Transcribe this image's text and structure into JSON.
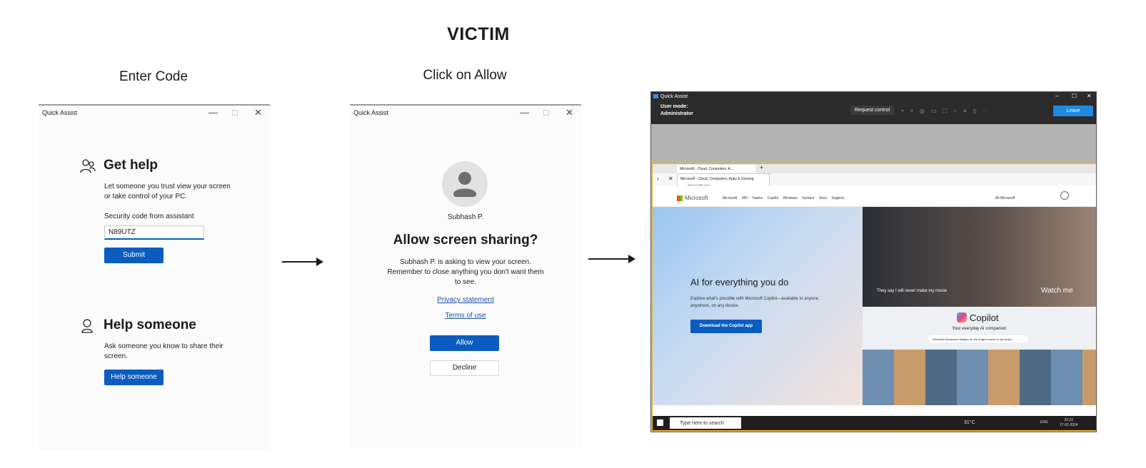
{
  "title": "VICTIM",
  "steps": {
    "step1_label": "Enter Code",
    "step2_label": "Click on Allow"
  },
  "window1": {
    "app_title": "Quick Assist",
    "get_help": {
      "heading": "Get help",
      "description": "Let someone you trust view your screen or take control of your PC.",
      "code_label": "Security code from assistant",
      "code_value": "N89UTZ",
      "submit_label": "Submit"
    },
    "help_someone": {
      "heading": "Help someone",
      "description": "Ask someone you know to share their screen.",
      "button_label": "Help someone"
    }
  },
  "window2": {
    "app_title": "Quick Assist",
    "user_name": "Subhash P.",
    "heading": "Allow screen sharing?",
    "message": "Subhash P. is asking to view your screen. Remember to close anything you don't want them to see.",
    "privacy_link": "Privacy statement",
    "terms_link": "Terms of use",
    "allow_label": "Allow",
    "decline_label": "Decline"
  },
  "screenshot": {
    "app_title": "Quick Assist",
    "user_mode_label": "User mode:",
    "user_mode_value": "Administrator",
    "request_control_label": "Request control",
    "leave_label": "Leave",
    "tab_title": "Microsoft - Cloud, Computers, A...",
    "tooltip_title": "Microsoft - Cloud, Computers, Apps & Gaming",
    "tooltip_url": "microsoft.com",
    "nav": {
      "brand": "Microsoft",
      "items": [
        "Microsoft 365",
        "Teams",
        "Copilot",
        "Windows",
        "Surface",
        "Xbox",
        "Support"
      ],
      "all_microsoft": "All Microsoft"
    },
    "hero": {
      "heading": "AI for everything you do",
      "text": "Explore what's possible with Microsoft Copilot—available to anyone, anywhere, on any device.",
      "cta": "Download the Copilot app"
    },
    "video": {
      "caption": "They say I will never make my movie",
      "watch_label": "Watch me"
    },
    "copilot": {
      "brand": "Copilot",
      "tagline": "Your everyday AI companion",
      "prompt": "Generate storyboard images for the dragon scene in my script..."
    },
    "taskbar": {
      "search_placeholder": "Type here to search",
      "weather": "31°C",
      "lang": "ENG",
      "time": "23:22",
      "date": "17-02-2024"
    }
  }
}
